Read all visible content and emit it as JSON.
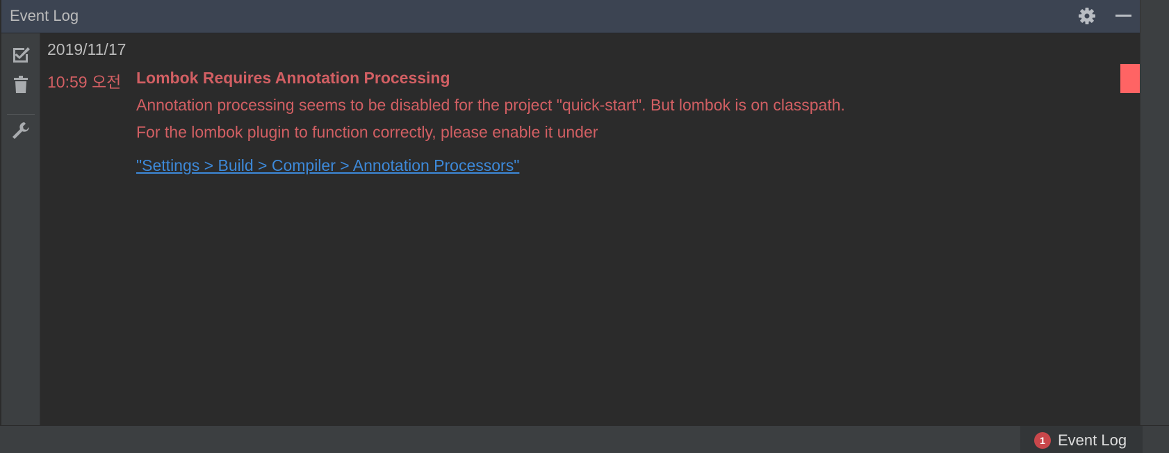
{
  "window": {
    "title": "Event Log"
  },
  "toolbar": {
    "icons": [
      "gear-icon",
      "minimize-icon"
    ]
  },
  "gutter": {
    "icons": [
      "mark-all-read-icon",
      "trash-icon",
      "wrench-icon"
    ]
  },
  "log": {
    "date": "2019/11/17",
    "entry": {
      "time": "10:59 오전",
      "title": "Lombok Requires Annotation Processing",
      "line1": "Annotation processing seems to be disabled for the project \"quick-start\". But lombok is on classpath.",
      "line2": "For the lombok plugin to function correctly, please enable it under",
      "link": "\"Settings > Build > Compiler > Annotation Processors\""
    }
  },
  "statusbar": {
    "badge_count": "1",
    "label": "Event Log"
  },
  "colors": {
    "error": "#d25f63",
    "link": "#3d89d9",
    "marker": "#ff6464",
    "badge": "#c9474b"
  }
}
